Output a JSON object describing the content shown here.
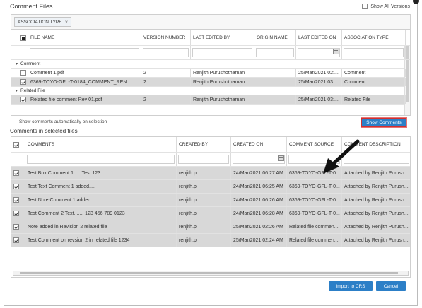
{
  "dialog": {
    "title": "Comment Files",
    "show_all_versions": "Show All Versions"
  },
  "filter_chip": {
    "label": "ASSOCIATION TYPE",
    "remove": "×"
  },
  "files": {
    "headers": [
      "FILE NAME",
      "VERSION NUMBER",
      "LAST EDITED BY",
      "ORIGIN NAME",
      "LAST EDITED ON",
      "ASSOCIATION TYPE"
    ],
    "groups": [
      {
        "name": "Comment",
        "rows": [
          {
            "checked": false,
            "file": "Comment 1.pdf",
            "version": "2",
            "editor": "Renjith Purushothaman",
            "origin": "",
            "edited_on": "25/Mar/2021 02:...",
            "assoc": "Comment",
            "selected": false
          },
          {
            "checked": true,
            "file": "6369-TOYO-GFL-T-0184_COMMENT_REN...",
            "version": "2",
            "editor": "Renjith Purushothaman",
            "origin": "",
            "edited_on": "25/Mar/2021 03:...",
            "assoc": "Comment",
            "selected": true
          }
        ]
      },
      {
        "name": "Related File",
        "rows": [
          {
            "checked": true,
            "file": "Related file comment Rev 01.pdf",
            "version": "2",
            "editor": "Renjith Purushothaman",
            "origin": "",
            "edited_on": "25/Mar/2021 03:...",
            "assoc": "Related File",
            "selected": true
          }
        ]
      }
    ]
  },
  "auto_show_label": "Show comments automatically on selection",
  "show_comments_button": "Show Comments",
  "comments_title": "Comments in selected files",
  "comments": {
    "headers": [
      "COMMENTS",
      "CREATED BY",
      "CREATED ON",
      "COMMENT SOURCE",
      "COMMENT DESCRIPTION"
    ],
    "rows": [
      {
        "text": "Test Box Comment 1......Test 123",
        "by": "renjith.p",
        "on": "24/Mar/2021 06:27 AM",
        "source": "6369-TOYO-GFL-T-0...",
        "desc": "Attached by Renjith Purush..."
      },
      {
        "text": "Test Text Comment 1 added....",
        "by": "renjith.p",
        "on": "24/Mar/2021 06:25 AM",
        "source": "6369-TOYO-GFL-T-0...",
        "desc": "Attached by Renjith Purush..."
      },
      {
        "text": "Test Note Comment 1 added.....",
        "by": "renjith.p",
        "on": "24/Mar/2021 06:26 AM",
        "source": "6369-TOYO-GFL-T-0...",
        "desc": "Attached by Renjith Purush..."
      },
      {
        "text": "Test Comment 2 Text....... 123 456 789 0123",
        "by": "renjith.p",
        "on": "24/Mar/2021 06:28 AM",
        "source": "6369-TOYO-GFL-T-0...",
        "desc": "Attached by Renjith Purush..."
      },
      {
        "text": "Note added in Revision 2 related file",
        "by": "renjith.p",
        "on": "25/Mar/2021 02:26 AM",
        "source": "Related file commen...",
        "desc": "Attached by Renjith Purush..."
      },
      {
        "text": "Test Comment on revsion 2 in related file 1234",
        "by": "renjith.p",
        "on": "25/Mar/2021 02:24 AM",
        "source": "Related file commen...",
        "desc": "Attached by Renjith Purush..."
      }
    ]
  },
  "buttons": {
    "import": "Import to CRS",
    "cancel": "Cancel"
  },
  "colors": {
    "accent": "#2c7fc7",
    "highlight_border": "#d32f2f",
    "selected_row": "#d8d8d8"
  }
}
